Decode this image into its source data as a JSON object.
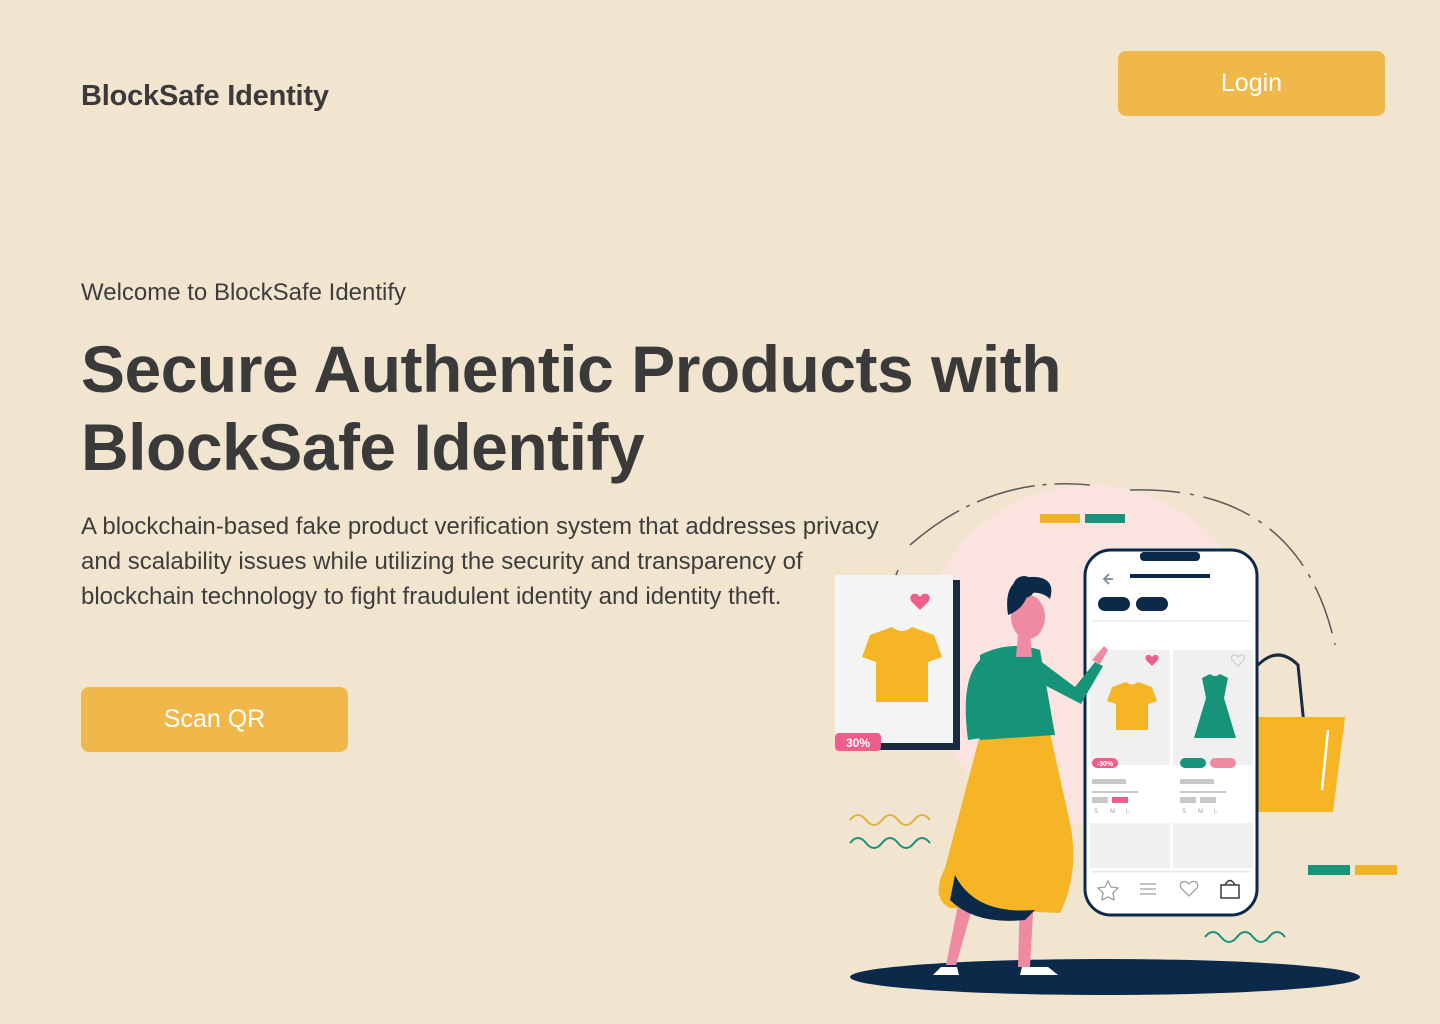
{
  "header": {
    "brand": "BlockSafe Identity",
    "login_label": "Login"
  },
  "hero": {
    "welcome": "Welcome to BlockSafe Identify",
    "headline_line1": "Secure Authentic Products with",
    "headline_line2": "BlockSafe Identify",
    "description": "A blockchain-based fake product verification system that addresses privacy and scalability issues while utilizing the security and transparency of blockchain technology to fight fraudulent identity and identity theft.",
    "scan_label": "Scan QR"
  },
  "illustration": {
    "discount_badge": "30%",
    "product_badge": "-30%",
    "size_labels": [
      "S",
      "M",
      "L"
    ]
  },
  "colors": {
    "background": "#f2e5cf",
    "accent": "#f0b84a",
    "text": "#3d3d3d",
    "green": "#16947a",
    "navy": "#0b2a4a",
    "pink": "#ef5d8a"
  }
}
